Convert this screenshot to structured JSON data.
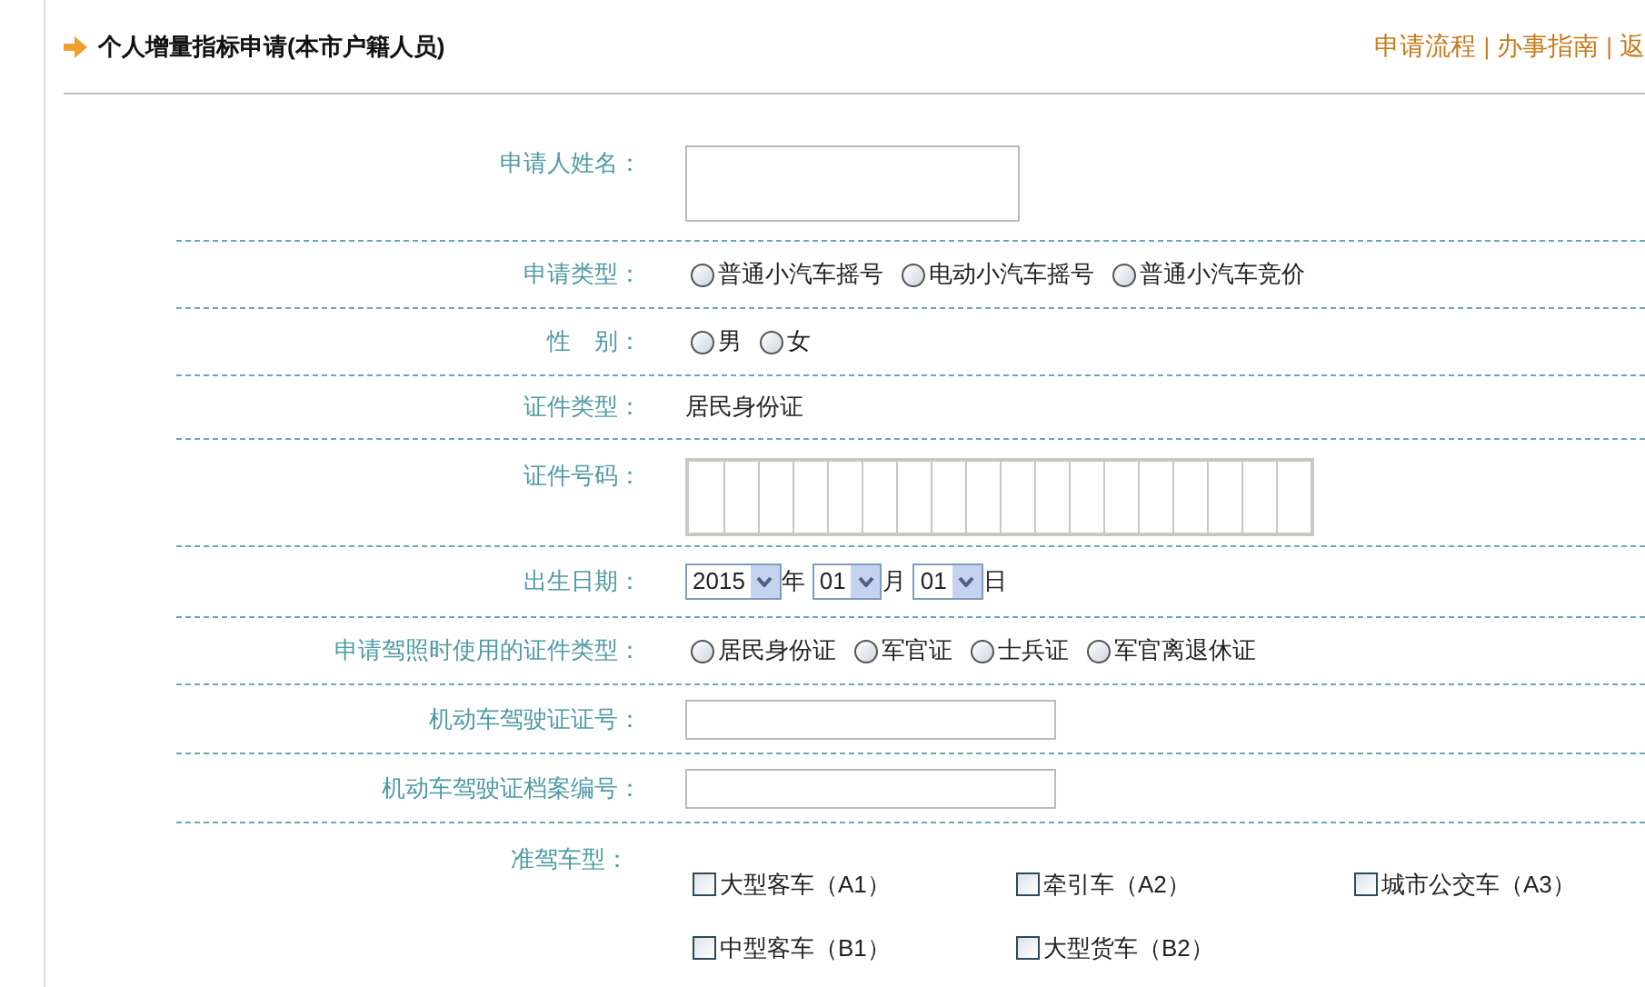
{
  "header": {
    "title": "个人增量指标申请(本市户籍人员)",
    "links": [
      {
        "kind": "link",
        "text": "申请流程"
      },
      {
        "kind": "separator",
        "text": "|"
      },
      {
        "kind": "link",
        "text": "办事指南"
      },
      {
        "kind": "separator",
        "text": "|"
      },
      {
        "kind": "link",
        "text": "返"
      }
    ]
  },
  "form": [
    {
      "kind": "textarea",
      "label": "申请人姓名："
    },
    {
      "kind": "radio",
      "label": "申请类型：",
      "options": [
        {
          "label": "普通小汽车摇号",
          "selected": false
        },
        {
          "label": "电动小汽车摇号",
          "selected": false
        },
        {
          "label": "普通小汽车竞价",
          "selected": false
        }
      ]
    },
    {
      "kind": "radio",
      "label": "性　别：",
      "options": [
        {
          "label": "男",
          "selected": false
        },
        {
          "label": "女",
          "selected": false
        }
      ]
    },
    {
      "kind": "static",
      "label": "证件类型：",
      "value": "居民身份证"
    },
    {
      "kind": "cells",
      "label": "证件号码："
    },
    {
      "kind": "date",
      "label": "出生日期：",
      "parts": [
        {
          "value": "2015",
          "unit": "年"
        },
        {
          "value": "01",
          "unit": "月"
        },
        {
          "value": "01",
          "unit": "日"
        }
      ]
    },
    {
      "kind": "radio",
      "label": "申请驾照时使用的证件类型：",
      "options": [
        {
          "label": "居民身份证",
          "selected": false
        },
        {
          "label": "军官证",
          "selected": false
        },
        {
          "label": "士兵证",
          "selected": false
        },
        {
          "label": "军官离退休证",
          "selected": false
        }
      ]
    },
    {
      "kind": "text",
      "label": "机动车驾驶证证号："
    },
    {
      "kind": "text",
      "label": "机动车驾驶证档案编号："
    },
    {
      "kind": "checkbox",
      "label": "准驾车型：",
      "options": [
        {
          "label": "大型客车（A1）",
          "checked": false
        },
        {
          "label": "牵引车（A2）",
          "checked": false
        },
        {
          "label": "城市公交车（A3）",
          "checked": false
        },
        {
          "label": "中型客车（B1）",
          "checked": false
        },
        {
          "label": "大型货车（B2）",
          "checked": false
        }
      ]
    }
  ]
}
